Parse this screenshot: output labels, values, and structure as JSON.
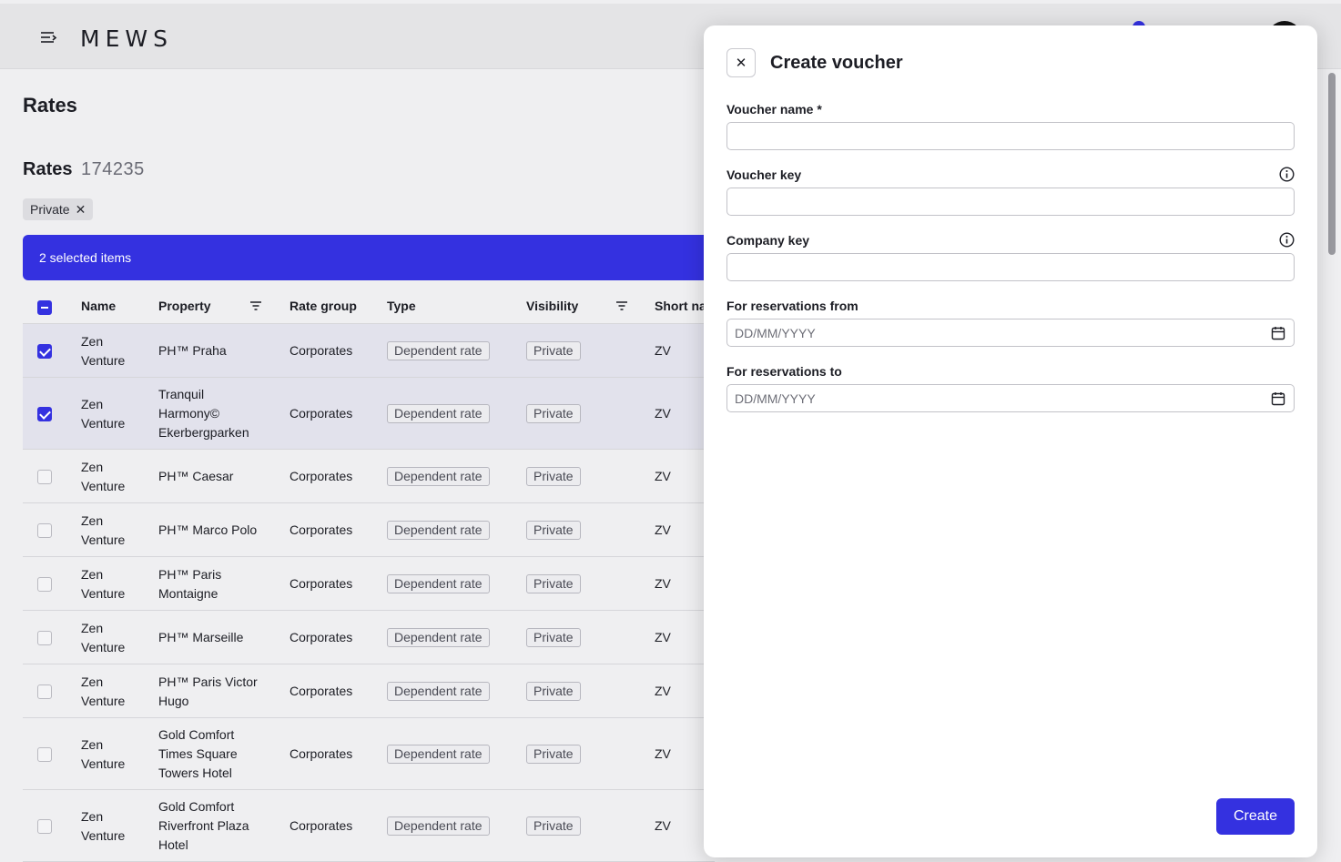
{
  "topbar": {
    "logo": "MEWS"
  },
  "page": {
    "title": "Rates"
  },
  "rates": {
    "heading": "Rates",
    "count": "174235"
  },
  "filter_chip": {
    "label": "Private",
    "remove": "✕"
  },
  "selection": {
    "label": "2 selected items"
  },
  "table": {
    "columns": {
      "name": "Name",
      "property": "Property",
      "rate_group": "Rate group",
      "type": "Type",
      "visibility": "Visibility",
      "short_name": "Short na"
    },
    "rows": [
      {
        "checked": true,
        "name": [
          "Zen",
          "Venture"
        ],
        "property": [
          "PH™ Praha"
        ],
        "rate_group": "Corporates",
        "type": "Dependent rate",
        "visibility": "Private",
        "short_name": "ZV"
      },
      {
        "checked": true,
        "name": [
          "Zen",
          "Venture"
        ],
        "property": [
          "Tranquil",
          "Harmony©",
          "Ekerbergparken"
        ],
        "rate_group": "Corporates",
        "type": "Dependent rate",
        "visibility": "Private",
        "short_name": "ZV"
      },
      {
        "checked": false,
        "name": [
          "Zen",
          "Venture"
        ],
        "property": [
          "PH™ Caesar"
        ],
        "rate_group": "Corporates",
        "type": "Dependent rate",
        "visibility": "Private",
        "short_name": "ZV"
      },
      {
        "checked": false,
        "name": [
          "Zen",
          "Venture"
        ],
        "property": [
          "PH™ Marco Polo"
        ],
        "rate_group": "Corporates",
        "type": "Dependent rate",
        "visibility": "Private",
        "short_name": "ZV"
      },
      {
        "checked": false,
        "name": [
          "Zen",
          "Venture"
        ],
        "property": [
          "PH™ Paris",
          "Montaigne"
        ],
        "rate_group": "Corporates",
        "type": "Dependent rate",
        "visibility": "Private",
        "short_name": "ZV"
      },
      {
        "checked": false,
        "name": [
          "Zen",
          "Venture"
        ],
        "property": [
          "PH™ Marseille"
        ],
        "rate_group": "Corporates",
        "type": "Dependent rate",
        "visibility": "Private",
        "short_name": "ZV"
      },
      {
        "checked": false,
        "name": [
          "Zen",
          "Venture"
        ],
        "property": [
          "PH™ Paris Victor",
          "Hugo"
        ],
        "rate_group": "Corporates",
        "type": "Dependent rate",
        "visibility": "Private",
        "short_name": "ZV"
      },
      {
        "checked": false,
        "name": [
          "Zen",
          "Venture"
        ],
        "property": [
          "Gold Comfort",
          "Times Square",
          "Towers Hotel"
        ],
        "rate_group": "Corporates",
        "type": "Dependent rate",
        "visibility": "Private",
        "short_name": "ZV"
      },
      {
        "checked": false,
        "name": [
          "Zen",
          "Venture"
        ],
        "property": [
          "Gold Comfort",
          "Riverfront Plaza",
          "Hotel"
        ],
        "rate_group": "Corporates",
        "type": "Dependent rate",
        "visibility": "Private",
        "short_name": "ZV"
      }
    ]
  },
  "panel": {
    "title": "Create voucher",
    "close": "✕",
    "fields": {
      "voucher_name": {
        "label": "Voucher name *",
        "value": ""
      },
      "voucher_key": {
        "label": "Voucher key",
        "value": ""
      },
      "company_key": {
        "label": "Company key",
        "value": ""
      },
      "from": {
        "label": "For reservations from",
        "placeholder": "DD/MM/YYYY"
      },
      "to": {
        "label": "For reservations to",
        "placeholder": "DD/MM/YYYY"
      }
    },
    "create_label": "Create"
  },
  "colors": {
    "accent": "#3431e0",
    "selected_row": "#e2e2ec"
  }
}
